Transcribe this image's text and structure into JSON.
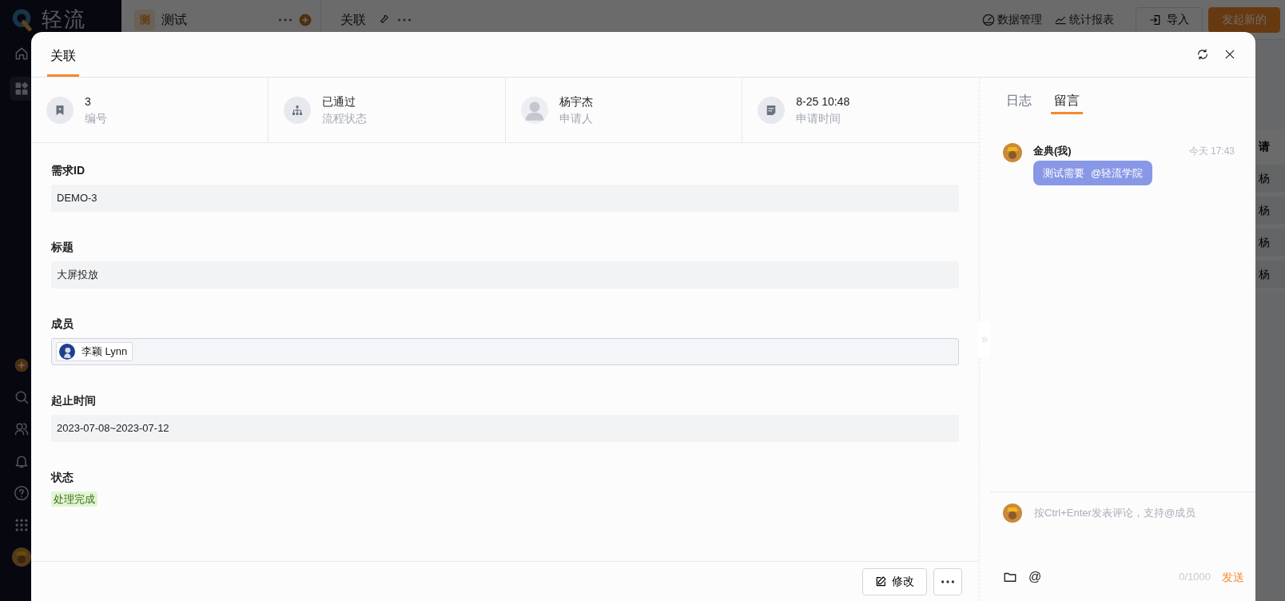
{
  "app": {
    "logo_text": "轻流",
    "sidebar_items": [
      {
        "kind": "home",
        "selected": false
      },
      {
        "kind": "apps",
        "selected": true
      }
    ],
    "sidebar_bottom": [
      {
        "kind": "add"
      },
      {
        "kind": "search"
      },
      {
        "kind": "users"
      },
      {
        "kind": "bell"
      },
      {
        "kind": "help"
      },
      {
        "kind": "grid"
      },
      {
        "kind": "avatar"
      }
    ]
  },
  "topbar": {
    "app_badge": "测",
    "app_name": "测试",
    "form_name": "关联",
    "actions": [
      {
        "kind": "data",
        "label": "数据管理"
      },
      {
        "kind": "chart",
        "label": "统计报表"
      }
    ],
    "buttons": [
      {
        "kind": "outline",
        "label": "导入"
      },
      {
        "kind": "primary",
        "label": "发起新的"
      }
    ]
  },
  "background_table": {
    "header": "请",
    "cells": [
      "杨",
      "杨",
      "杨",
      "杨"
    ]
  },
  "modal": {
    "tabs": [
      {
        "label": "关联",
        "selected": true
      }
    ],
    "summary": [
      {
        "kind": "id",
        "value": "3",
        "label": "编号"
      },
      {
        "kind": "flow",
        "value": "已通过",
        "label": "流程状态"
      },
      {
        "kind": "person",
        "value": "杨宇杰",
        "label": "申请人"
      },
      {
        "kind": "time",
        "value": "8-25 10:48",
        "label": "申请时间"
      }
    ],
    "fields": [
      {
        "kind": "text",
        "label": "需求ID",
        "value": "DEMO-3"
      },
      {
        "kind": "text",
        "label": "标题",
        "value": "大屏投放"
      },
      {
        "kind": "members",
        "label": "成员",
        "members": [
          "李颖 Lynn"
        ]
      },
      {
        "kind": "text",
        "label": "起止时间",
        "value": "2023-07-08~2023-07-12"
      },
      {
        "kind": "tag",
        "label": "状态",
        "value": "处理完成"
      }
    ],
    "footer_buttons": [
      {
        "kind": "edit",
        "label": "修改"
      },
      {
        "kind": "more"
      }
    ],
    "side_tabs": [
      {
        "label": "日志",
        "selected": false
      },
      {
        "label": "留言",
        "selected": true
      }
    ],
    "comments": [
      {
        "author": "金典(我)",
        "time": "今天 17:43",
        "text": "测试需要",
        "mention": "@轻流学院"
      }
    ],
    "composer": {
      "placeholder": "按Ctrl+Enter发表评论，支持@成员",
      "at_symbol": "@",
      "counter": "0/1000",
      "send": "发送"
    }
  }
}
